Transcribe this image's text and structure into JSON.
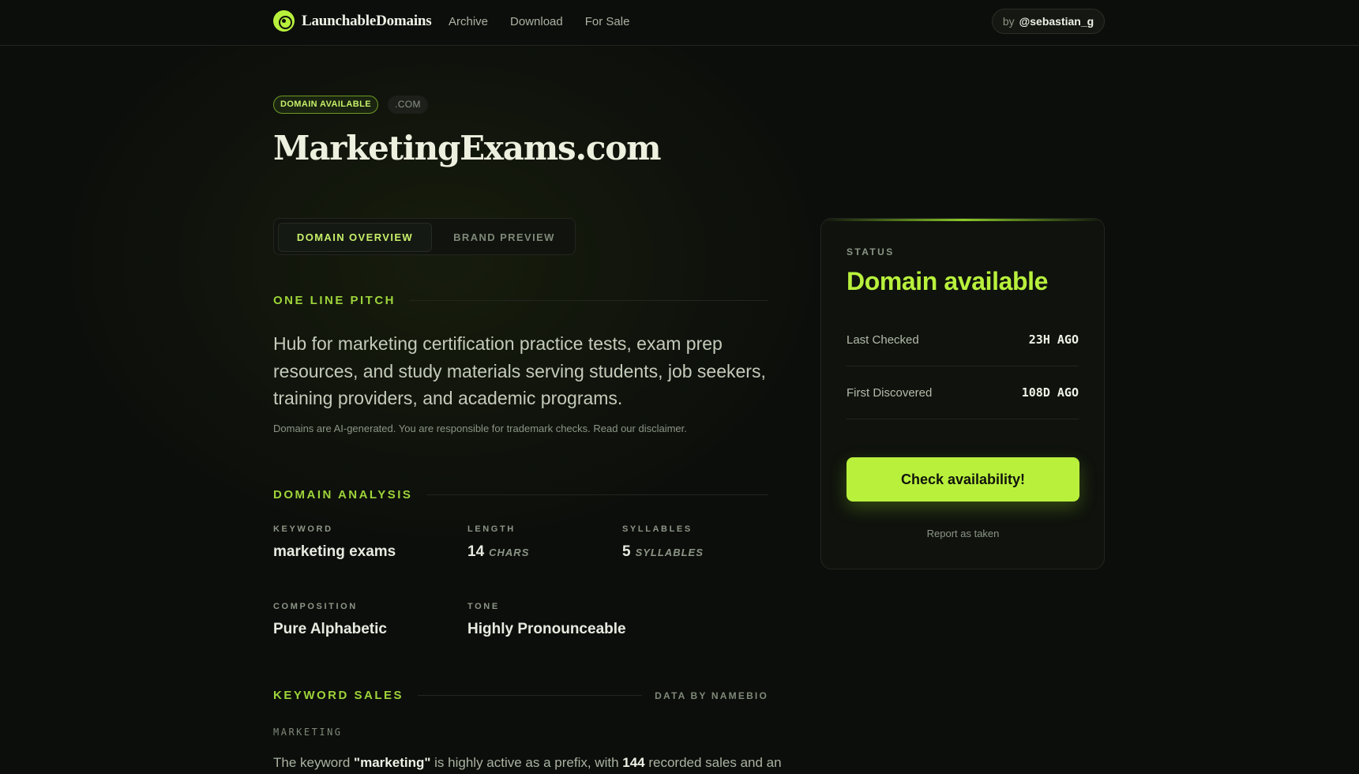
{
  "header": {
    "brand": "LaunchableDomains",
    "nav": [
      "Archive",
      "Download",
      "For Sale"
    ],
    "author_prefix": "by",
    "author_handle": "@sebastian_g"
  },
  "hero": {
    "badge_available": "DOMAIN AVAILABLE",
    "badge_tld": ".COM",
    "domain": "MarketingExams.com"
  },
  "tabs": [
    "DOMAIN OVERVIEW",
    "BRAND PREVIEW"
  ],
  "pitch": {
    "heading": "ONE LINE PITCH",
    "text": "Hub for marketing certification practice tests, exam prep resources, and study materials serving students, job seekers, training providers, and academic programs.",
    "disclaimer": "Domains are AI-generated. You are responsible for trademark checks. Read our disclaimer."
  },
  "analysis": {
    "heading": "DOMAIN ANALYSIS",
    "keyword": {
      "label": "KEYWORD",
      "value": "marketing exams"
    },
    "length": {
      "label": "LENGTH",
      "value": "14",
      "unit": "CHARS"
    },
    "syllables": {
      "label": "SYLLABLES",
      "value": "5",
      "unit": "SYLLABLES"
    },
    "composition": {
      "label": "COMPOSITION",
      "value": "Pure Alphabetic"
    },
    "tone": {
      "label": "TONE",
      "value": "Highly Pronounceable"
    }
  },
  "keyword_sales": {
    "heading": "KEYWORD SALES",
    "source": "DATA BY NAMEBIO",
    "keyword_label": "MARKETING",
    "text_pre": "The keyword ",
    "keyword": "\"marketing\"",
    "text_mid": " is highly active as a prefix, with ",
    "count": "144",
    "text_post": " recorded sales and an"
  },
  "status_card": {
    "label": "STATUS",
    "value": "Domain available",
    "rows": [
      {
        "label": "Last Checked",
        "value": "23H AGO"
      },
      {
        "label": "First Discovered",
        "value": "108D AGO"
      }
    ],
    "button": "Check availability!",
    "report": "Report as taken"
  },
  "colors": {
    "accent": "#b8f03c",
    "background": "#0c0e0b"
  }
}
